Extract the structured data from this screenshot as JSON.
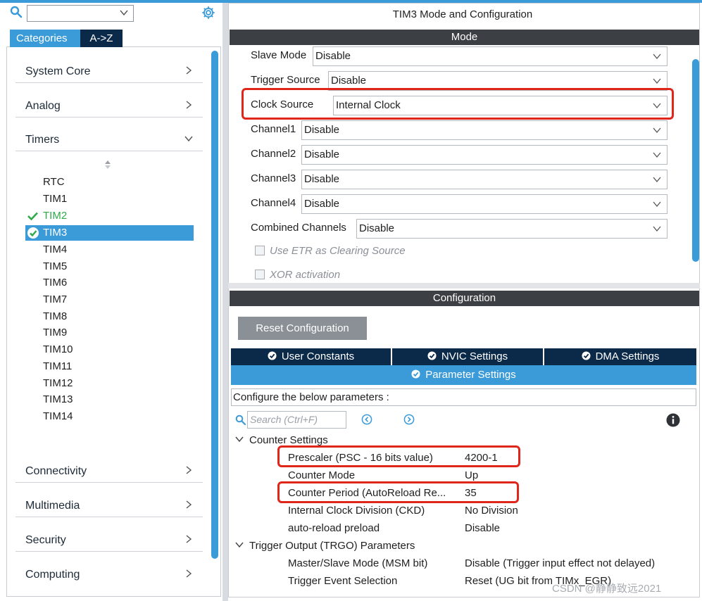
{
  "colors": {
    "accent": "#3a9bd8",
    "dark_header": "#3c3f44",
    "navy_tab": "#0b2a4a",
    "highlight": "#e0251b",
    "ok_green": "#2eaa4a"
  },
  "left": {
    "tabs": {
      "categories": "Categories",
      "az": "A->Z"
    },
    "categories_top": [
      {
        "label": "System Core",
        "icon": "chevron-right-icon"
      },
      {
        "label": "Analog",
        "icon": "chevron-right-icon"
      },
      {
        "label": "Timers",
        "icon": "chevron-down-icon"
      }
    ],
    "timers": [
      {
        "label": "RTC",
        "state": "none"
      },
      {
        "label": "TIM1",
        "state": "none"
      },
      {
        "label": "TIM2",
        "state": "configured"
      },
      {
        "label": "TIM3",
        "state": "selected"
      },
      {
        "label": "TIM4",
        "state": "none"
      },
      {
        "label": "TIM5",
        "state": "none"
      },
      {
        "label": "TIM6",
        "state": "none"
      },
      {
        "label": "TIM7",
        "state": "none"
      },
      {
        "label": "TIM8",
        "state": "none"
      },
      {
        "label": "TIM9",
        "state": "none"
      },
      {
        "label": "TIM10",
        "state": "none"
      },
      {
        "label": "TIM11",
        "state": "none"
      },
      {
        "label": "TIM12",
        "state": "none"
      },
      {
        "label": "TIM13",
        "state": "none"
      },
      {
        "label": "TIM14",
        "state": "none"
      }
    ],
    "categories_bottom": [
      {
        "label": "Connectivity",
        "icon": "chevron-right-icon"
      },
      {
        "label": "Multimedia",
        "icon": "chevron-right-icon"
      },
      {
        "label": "Security",
        "icon": "chevron-right-icon"
      },
      {
        "label": "Computing",
        "icon": "chevron-right-icon"
      }
    ]
  },
  "right": {
    "title": "TIM3 Mode and Configuration",
    "mode_header": "Mode",
    "mode_rows": [
      {
        "label": "Slave Mode",
        "value": "Disable"
      },
      {
        "label": "Trigger Source",
        "value": "Disable"
      },
      {
        "label": "Clock Source",
        "value": "Internal Clock"
      },
      {
        "label": "Channel1",
        "value": "Disable"
      },
      {
        "label": "Channel2",
        "value": "Disable"
      },
      {
        "label": "Channel3",
        "value": "Disable"
      },
      {
        "label": "Channel4",
        "value": "Disable"
      },
      {
        "label": "Combined Channels",
        "value": "Disable"
      }
    ],
    "checkboxes": [
      {
        "label": "Use ETR as Clearing Source"
      },
      {
        "label": "XOR activation"
      }
    ],
    "config_header": "Configuration",
    "reset_button": "Reset Configuration",
    "tabs": [
      "User Constants",
      "NVIC Settings",
      "DMA Settings"
    ],
    "active_tab": "Parameter Settings",
    "configure_text": "Configure the below parameters :",
    "search_placeholder": "Search (Ctrl+F)",
    "groups": [
      {
        "label": "Counter Settings",
        "params": [
          {
            "name": "Prescaler (PSC - 16 bits value)",
            "value": "4200-1"
          },
          {
            "name": "Counter Mode",
            "value": "Up"
          },
          {
            "name": "Counter Period (AutoReload Re...",
            "value": "35"
          },
          {
            "name": "Internal Clock Division (CKD)",
            "value": "No Division"
          },
          {
            "name": "auto-reload preload",
            "value": "Disable"
          }
        ]
      },
      {
        "label": "Trigger Output (TRGO) Parameters",
        "params": [
          {
            "name": "Master/Slave Mode (MSM bit)",
            "value": "Disable (Trigger input effect not delayed)"
          },
          {
            "name": "Trigger Event Selection",
            "value": "Reset (UG bit from TIMx_EGR)"
          }
        ]
      }
    ]
  },
  "watermark": "CSDN @静静致远2021"
}
